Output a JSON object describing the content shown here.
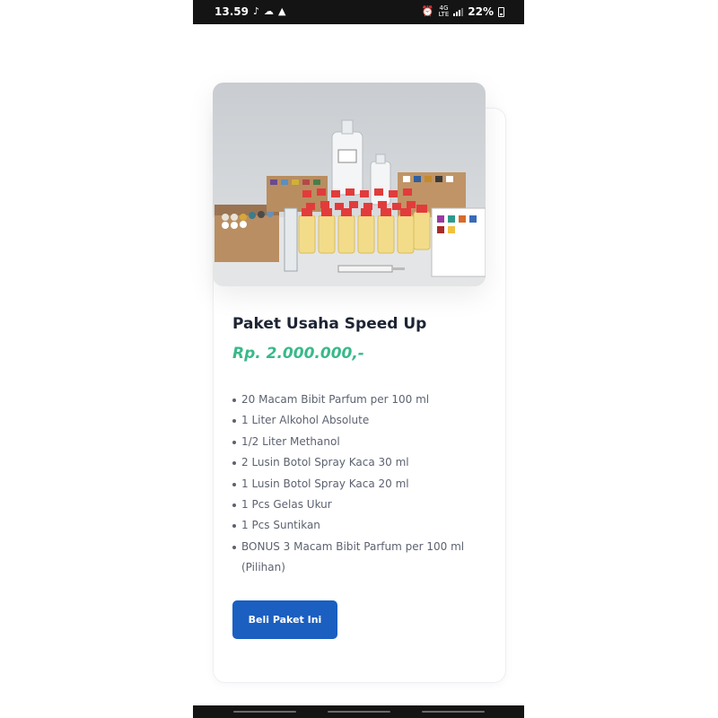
{
  "status_bar": {
    "time": "13.59",
    "network_top": "4G",
    "network_bottom": "LTE",
    "battery": "22%",
    "icons": [
      "tiktok-icon",
      "cloud-icon",
      "warning-icon",
      "alarm-icon",
      "signal-icon",
      "battery-icon"
    ]
  },
  "product": {
    "image_alt": "perfume-starter-kit-photo",
    "title": "Paket Usaha Speed Up",
    "price": "Rp. 2.000.000,-",
    "features": [
      "20 Macam Bibit Parfum per 100 ml",
      "1 Liter Alkohol Absolute",
      "1/2 Liter Methanol",
      "2 Lusin Botol Spray Kaca 30 ml",
      "1 Lusin Botol Spray Kaca 20 ml",
      "1 Pcs Gelas Ukur",
      "1 Pcs Suntikan",
      "BONUS 3 Macam Bibit Parfum per 100 ml (Pilihan)"
    ],
    "button_label": "Beli Paket Ini"
  },
  "colors": {
    "title": "#1d2433",
    "price": "#39b98a",
    "text": "#5c6270",
    "button": "#1b5fc1",
    "status_bar": "#141414"
  }
}
